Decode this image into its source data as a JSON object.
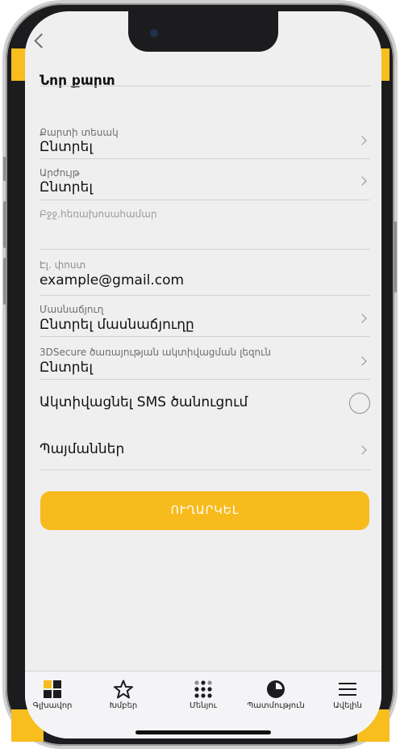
{
  "header": {
    "title": "Նոր քարտ"
  },
  "form": {
    "card_type": {
      "label": "Քարտի տեսակ",
      "value": "Ընտրել"
    },
    "currency": {
      "label": "Արժույթ",
      "value": "Ընտրել"
    },
    "mobile": {
      "placeholder": "Բջջ.հեռախոսահամար"
    },
    "email": {
      "label": "Էլ. փոստ",
      "value": "example@gmail.com"
    },
    "branch": {
      "label": "Մասնաճյուղ",
      "value": "Ընտրել մասնաճյուղը"
    },
    "secure_lang": {
      "label": "3DSecure ծառայության ակտիվացման լեզուն",
      "value": "Ընտրել"
    },
    "sms": {
      "label": "Ակտիվացնել SMS ծանուցում",
      "checked": false
    },
    "terms": {
      "label": "Պայմաններ"
    },
    "submit_label": "ՈՒՂԱՐԿԵԼ"
  },
  "tabbar": {
    "items": [
      {
        "label": "Գլխավոր",
        "icon": "grid-icon"
      },
      {
        "label": "Խմբեր",
        "icon": "star-icon"
      },
      {
        "label": "Մենյու",
        "icon": "dots-grid-icon"
      },
      {
        "label": "Պատմություն",
        "icon": "clock-pie-icon"
      },
      {
        "label": "Ավելին",
        "icon": "hamburger-icon"
      }
    ]
  },
  "colors": {
    "accent": "#f7bb1e",
    "background": "#efeff0",
    "text": "#111111",
    "muted": "#6e6e73"
  }
}
